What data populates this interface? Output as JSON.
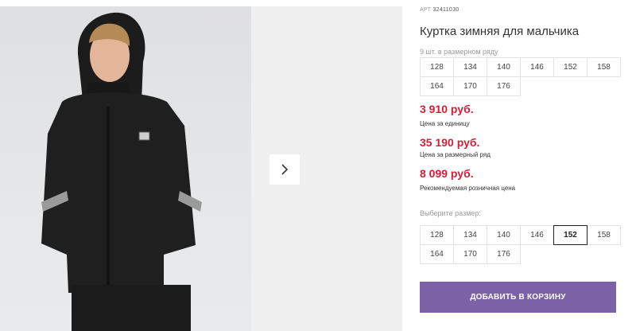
{
  "product": {
    "sku_label": "АРТ",
    "sku": "32411030",
    "title": "Куртка зимняя для мальчика"
  },
  "pack": {
    "label": "9 шт. в размерном ряду",
    "sizes": [
      "128",
      "134",
      "140",
      "146",
      "152",
      "158",
      "164",
      "170",
      "176"
    ]
  },
  "prices": {
    "unit_price": "3 910 руб.",
    "unit_label": "Цена за единицу",
    "row_price": "35 190 руб.",
    "row_label": "Цена за размерный ряд",
    "retail_price": "8 099 руб.",
    "retail_label": "Рекомендуемая розничная цена",
    "color": "#d11f37"
  },
  "size_select": {
    "label": "Выберите размер:",
    "sizes": [
      "128",
      "134",
      "140",
      "146",
      "152",
      "158",
      "164",
      "170",
      "176"
    ],
    "selected": "152"
  },
  "cart": {
    "button_label": "ДОБАВИТЬ В КОРЗИНУ",
    "color": "#7b62a6"
  },
  "gallery": {
    "next_icon": "chevron-right-icon"
  }
}
